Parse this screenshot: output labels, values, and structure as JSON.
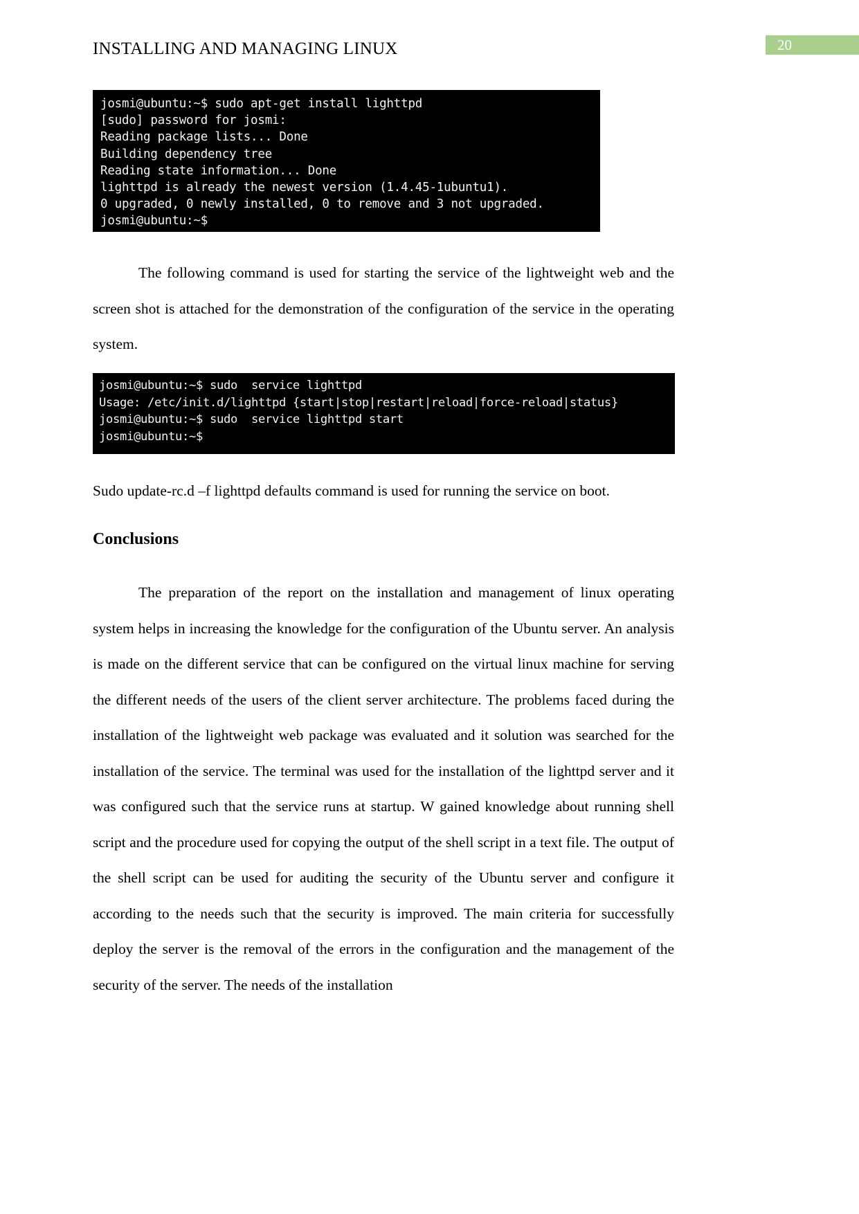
{
  "header": {
    "title": "INSTALLING AND MANAGING LINUX",
    "page_number": "20",
    "badge_color": "#a9cf8f"
  },
  "terminal_1": {
    "lines": [
      "josmi@ubuntu:~$ sudo apt-get install lighttpd",
      "[sudo] password for josmi:",
      "Reading package lists... Done",
      "Building dependency tree",
      "Reading state information... Done",
      "lighttpd is already the newest version (1.4.45-1ubuntu1).",
      "0 upgraded, 0 newly installed, 0 to remove and 3 not upgraded.",
      "josmi@ubuntu:~$"
    ]
  },
  "terminal_2": {
    "lines": [
      "josmi@ubuntu:~$ sudo  service lighttpd",
      "Usage: /etc/init.d/lighttpd {start|stop|restart|reload|force-reload|status}",
      "josmi@ubuntu:~$ sudo  service lighttpd start",
      "josmi@ubuntu:~$"
    ]
  },
  "body": {
    "para_following": "The following command is used for starting the service of the lightweight web and the screen shot is attached for the demonstration of the configuration of the service in the operating system.",
    "para_sudo_update": "Sudo update-rc.d –f lighttpd defaults command is used for running the service on boot.",
    "heading_conclusions": "Conclusions",
    "para_conclusion": "The preparation of the report on the installation and management of linux operating system helps in increasing the knowledge for the configuration of the Ubuntu server. An analysis is made on the different service that can be configured on the virtual linux machine for serving the different needs of the users of the client server architecture. The problems faced during the installation of the lightweight web package was evaluated and it solution was searched for the installation of the service. The terminal was used for the installation of the lighttpd server and it was configured such that the service runs at startup. W gained knowledge about running shell script and the procedure used for copying the output of the shell script in a text file. The output of the shell script can be used for auditing the security of the Ubuntu server and configure it according to the needs such that the security is improved. The main criteria for successfully deploy the server is the removal of the errors in the configuration and the management of the security of the server. The needs of the installation"
  }
}
